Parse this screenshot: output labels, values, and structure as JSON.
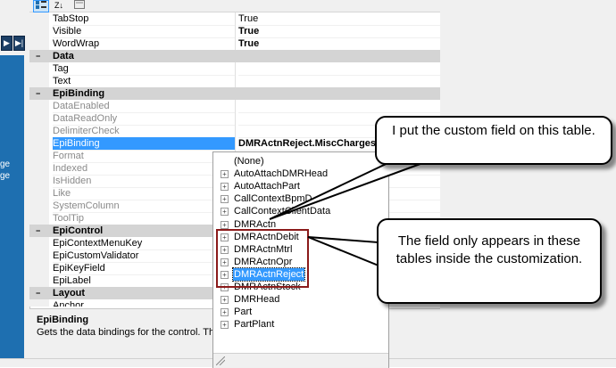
{
  "left_panel": {
    "items": [
      "ge",
      "ge"
    ],
    "nav_last_glyph": "▶|"
  },
  "toolbar": {
    "categorized_icon": "grid-icon",
    "alpha_sort_label": "Z↓",
    "pages_icon": "pages-icon"
  },
  "properties": {
    "rows": [
      {
        "type": "prop",
        "name": "TabStop",
        "value": "True",
        "value_bold": false,
        "name_gray": false
      },
      {
        "type": "prop",
        "name": "Visible",
        "value": "True",
        "value_bold": true,
        "name_gray": false
      },
      {
        "type": "prop",
        "name": "WordWrap",
        "value": "True",
        "value_bold": true,
        "name_gray": false
      },
      {
        "type": "category",
        "name": "Data",
        "toggle": "−"
      },
      {
        "type": "prop",
        "name": "Tag",
        "value": "",
        "value_bold": false,
        "name_gray": false
      },
      {
        "type": "prop",
        "name": "Text",
        "value": "",
        "value_bold": false,
        "name_gray": false
      },
      {
        "type": "category",
        "name": "EpiBinding",
        "toggle": "−"
      },
      {
        "type": "prop",
        "name": "DataEnabled",
        "value": "",
        "value_bold": false,
        "name_gray": true
      },
      {
        "type": "prop",
        "name": "DataReadOnly",
        "value": "",
        "value_bold": false,
        "name_gray": true
      },
      {
        "type": "prop",
        "name": "DelimiterCheck",
        "value": "",
        "value_bold": false,
        "name_gray": true
      },
      {
        "type": "prop",
        "name": "EpiBinding",
        "value": "DMRActnReject.MiscCharges",
        "value_bold": true,
        "name_gray": false,
        "selected": true
      },
      {
        "type": "prop",
        "name": "Format",
        "value": "",
        "value_bold": false,
        "name_gray": true
      },
      {
        "type": "prop",
        "name": "Indexed",
        "value": "",
        "value_bold": false,
        "name_gray": true
      },
      {
        "type": "prop",
        "name": "IsHidden",
        "value": "",
        "value_bold": false,
        "name_gray": true
      },
      {
        "type": "prop",
        "name": "Like",
        "value": "",
        "value_bold": false,
        "name_gray": true
      },
      {
        "type": "prop",
        "name": "SystemColumn",
        "value": "",
        "value_bold": false,
        "name_gray": true
      },
      {
        "type": "prop",
        "name": "ToolTip",
        "value": "",
        "value_bold": false,
        "name_gray": true
      },
      {
        "type": "category",
        "name": "EpiControl",
        "toggle": "−"
      },
      {
        "type": "prop",
        "name": "EpiContextMenuKey",
        "value": "",
        "value_bold": false,
        "name_gray": false
      },
      {
        "type": "prop",
        "name": "EpiCustomValidator",
        "value": "",
        "value_bold": false,
        "name_gray": false
      },
      {
        "type": "prop",
        "name": "EpiKeyField",
        "value": "",
        "value_bold": false,
        "name_gray": false
      },
      {
        "type": "prop",
        "name": "EpiLabel",
        "value": "",
        "value_bold": false,
        "name_gray": false
      },
      {
        "type": "category",
        "name": "Layout",
        "toggle": "−"
      },
      {
        "type": "prop",
        "name": "Anchor",
        "value": "",
        "value_bold": false,
        "name_gray": false
      }
    ]
  },
  "description": {
    "title": "EpiBinding",
    "text": "Gets the data bindings for the control. The forma"
  },
  "binding_dropdown": {
    "items": [
      {
        "label": "(None)",
        "expandable": false,
        "selected": false
      },
      {
        "label": "AutoAttachDMRHead",
        "expandable": true,
        "selected": false
      },
      {
        "label": "AutoAttachPart",
        "expandable": true,
        "selected": false
      },
      {
        "label": "CallContextBpmD",
        "expandable": true,
        "selected": false
      },
      {
        "label": "CallContextClientData",
        "expandable": true,
        "selected": false
      },
      {
        "label": "DMRActn",
        "expandable": true,
        "selected": false
      },
      {
        "label": "DMRActnDebit",
        "expandable": true,
        "selected": false
      },
      {
        "label": "DMRActnMtrl",
        "expandable": true,
        "selected": false
      },
      {
        "label": "DMRActnOpr",
        "expandable": true,
        "selected": false
      },
      {
        "label": "DMRActnReject",
        "expandable": true,
        "selected": true
      },
      {
        "label": "DMRActnStock",
        "expandable": true,
        "selected": false
      },
      {
        "label": "DMRHead",
        "expandable": true,
        "selected": false
      },
      {
        "label": "Part",
        "expandable": true,
        "selected": false
      },
      {
        "label": "PartPlant",
        "expandable": true,
        "selected": false
      }
    ]
  },
  "callouts": {
    "top": "I put the custom field on this table.",
    "bottom": "The field only appears in these tables inside the customization."
  },
  "colors": {
    "selection": "#3399ff",
    "highlight_box": "#8b1a1a",
    "category_band": "#d4d4d4"
  }
}
